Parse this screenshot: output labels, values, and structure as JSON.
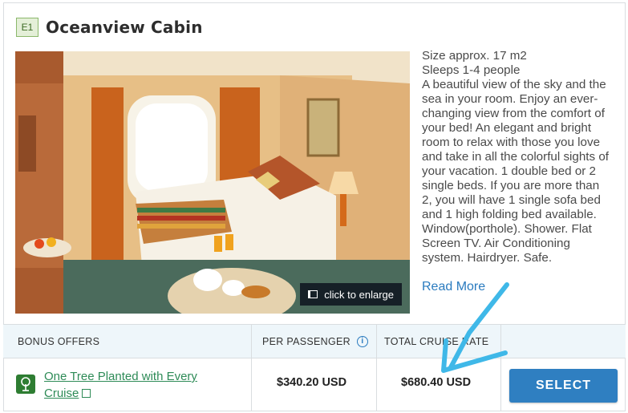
{
  "cabin": {
    "code": "E1",
    "title": "Oceanview Cabin",
    "photo_alt": "Oceanview cabin photo",
    "enlarge_label": "click to enlarge",
    "description": [
      "Size approx. 17 m2",
      "Sleeps 1-4 people",
      "A beautiful view of the sky and the sea in your room. Enjoy an ever-changing view from the comfort of your bed! An elegant and bright room to relax with those you love and take in all the colorful sights of your vacation. 1 double bed or 2 single beds. If you are more than 2, you will have 1 single sofa bed and 1 high folding bed available. Window(porthole). Shower. Flat Screen TV. Air Conditioning system. Hairdryer. Safe."
    ],
    "read_more": "Read More"
  },
  "table": {
    "headers": {
      "bonus_offers": "BONUS OFFERS",
      "per_passenger": "PER PASSENGER",
      "total_cruise_rate": "TOTAL CRUISE RATE"
    },
    "row": {
      "offer_line1": "One Tree Planted with Every",
      "offer_line2": "Cruise",
      "per_passenger": "$340.20 USD",
      "total": "$680.40 USD",
      "select_label": "SELECT"
    }
  },
  "icons": [
    "tree-icon",
    "info-icon",
    "external-link-icon",
    "enlarge-icon"
  ],
  "colors": {
    "accent_blue": "#2f7fc1",
    "link_green": "#2e8b57",
    "header_bg": "#eef6fa",
    "annotation_arrow": "#3fb8e8"
  }
}
